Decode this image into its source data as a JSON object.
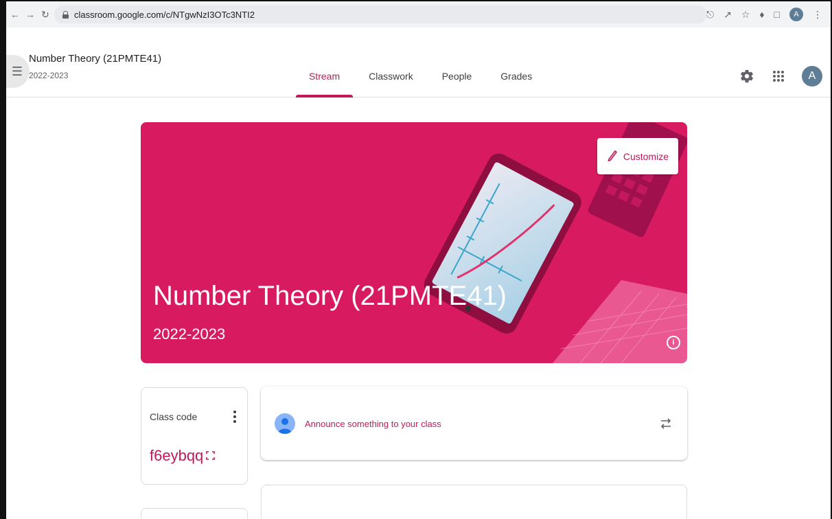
{
  "browser": {
    "url": "classroom.google.com/c/NTgwNzI3OTc3NTI2",
    "profile_initial": "A",
    "icons": [
      "back-arrow",
      "forward-arrow",
      "reload",
      "lock",
      "install",
      "share",
      "star",
      "extensions",
      "sidepanel",
      "profile",
      "more"
    ]
  },
  "header": {
    "class_title": "Number Theory (21PMTE41)",
    "class_subtitle": "2022-2023",
    "tabs": [
      {
        "label": "Stream",
        "active": true
      },
      {
        "label": "Classwork",
        "active": false
      },
      {
        "label": "People",
        "active": false
      },
      {
        "label": "Grades",
        "active": false
      }
    ],
    "avatar_initial": "A"
  },
  "banner": {
    "title": "Number Theory (21PMTE41)",
    "subtitle": "2022-2023",
    "customize_label": "Customize",
    "color": "#d81b60"
  },
  "class_code": {
    "label": "Class code",
    "value": "f6eybqq"
  },
  "announce": {
    "placeholder": "Announce something to your class"
  },
  "colors": {
    "accent": "#c2185b",
    "banner": "#d81b60",
    "avatar": "#5f7d95"
  }
}
